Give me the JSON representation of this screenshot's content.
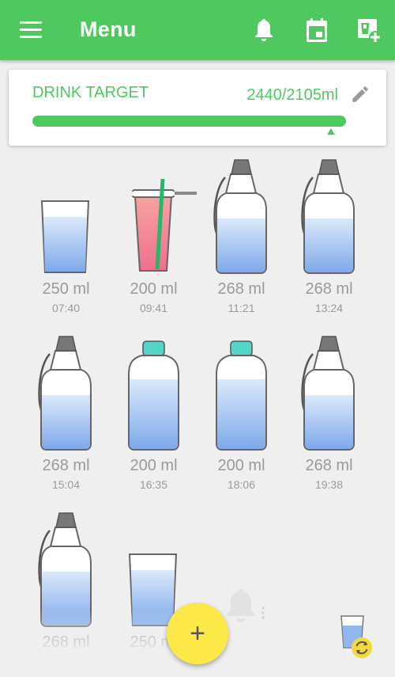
{
  "header": {
    "title": "Menu",
    "accent_color": "#4fc95f",
    "icons": [
      "menu-icon",
      "bell-icon",
      "calendar-icon",
      "add-cup-icon"
    ]
  },
  "target": {
    "label": "DRINK TARGET",
    "value": "2440/2105ml",
    "progress_percent": 100,
    "edit_icon": "pencil-icon"
  },
  "drinks": [
    {
      "type": "glass",
      "amount": "250 ml",
      "time": "07:40"
    },
    {
      "type": "cup",
      "amount": "200 ml",
      "time": "09:41"
    },
    {
      "type": "bottle",
      "amount": "268 ml",
      "time": "11:21"
    },
    {
      "type": "bottle",
      "amount": "268 ml",
      "time": "13:24"
    },
    {
      "type": "bottle",
      "amount": "268 ml",
      "time": "15:04"
    },
    {
      "type": "capped",
      "amount": "200 ml",
      "time": "16:35"
    },
    {
      "type": "capped",
      "amount": "200 ml",
      "time": "18:06"
    },
    {
      "type": "bottle",
      "amount": "268 ml",
      "time": "19:38"
    },
    {
      "type": "bottle",
      "amount": "268 ml",
      "time": ""
    },
    {
      "type": "glass",
      "amount": "250 ml",
      "time": ""
    }
  ],
  "fab": {
    "label": "+",
    "color": "#fde84a"
  },
  "cup_switch_icon": "refresh-icon"
}
